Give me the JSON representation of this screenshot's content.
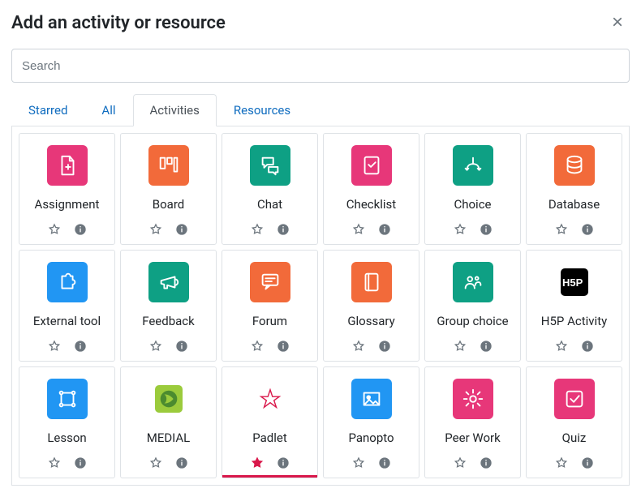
{
  "header": {
    "title": "Add an activity or resource"
  },
  "search": {
    "placeholder": "Search"
  },
  "tabs": {
    "starred": "Starred",
    "all": "All",
    "activities": "Activities",
    "resources": "Resources",
    "active": "activities"
  },
  "colors": {
    "pink": "#e73779",
    "green": "#0ea084",
    "orange": "#f26a3a",
    "blue": "#2196f3",
    "yellowgreen": "#9bcb3c",
    "black": "#000000",
    "white": "#ffffff"
  },
  "items": [
    {
      "id": "assignment",
      "label": "Assignment",
      "bg": "pink",
      "icon": "file-plus",
      "starred": false
    },
    {
      "id": "board",
      "label": "Board",
      "bg": "orange",
      "icon": "kanban",
      "starred": false
    },
    {
      "id": "chat",
      "label": "Chat",
      "bg": "green",
      "icon": "bubbles",
      "starred": false
    },
    {
      "id": "checklist",
      "label": "Checklist",
      "bg": "pink",
      "icon": "check-box",
      "starred": false
    },
    {
      "id": "choice",
      "label": "Choice",
      "bg": "green",
      "icon": "fork",
      "starred": false
    },
    {
      "id": "database",
      "label": "Database",
      "bg": "orange",
      "icon": "db",
      "starred": false
    },
    {
      "id": "externaltool",
      "label": "External tool",
      "bg": "blue",
      "icon": "puzzle",
      "starred": false
    },
    {
      "id": "feedback",
      "label": "Feedback",
      "bg": "green",
      "icon": "megaphone",
      "starred": false
    },
    {
      "id": "forum",
      "label": "Forum",
      "bg": "orange",
      "icon": "speech",
      "starred": false
    },
    {
      "id": "glossary",
      "label": "Glossary",
      "bg": "orange",
      "icon": "book",
      "starred": false
    },
    {
      "id": "groupchoice",
      "label": "Group choice",
      "bg": "green",
      "icon": "group",
      "starred": false
    },
    {
      "id": "h5p",
      "label": "H5P Activity",
      "bg": "black",
      "icon": "h5p",
      "starred": false
    },
    {
      "id": "lesson",
      "label": "Lesson",
      "bg": "blue",
      "icon": "path",
      "starred": false
    },
    {
      "id": "medial",
      "label": "MEDIAL",
      "bg": "yellowgreen",
      "icon": "medial",
      "starred": false
    },
    {
      "id": "padlet",
      "label": "Padlet",
      "bg": "white",
      "icon": "padlet",
      "starred": true
    },
    {
      "id": "panopto",
      "label": "Panopto",
      "bg": "blue",
      "icon": "image",
      "starred": false
    },
    {
      "id": "peerwork",
      "label": "Peer Work",
      "bg": "pink",
      "icon": "gear",
      "starred": false
    },
    {
      "id": "quiz",
      "label": "Quiz",
      "bg": "pink",
      "icon": "tick-square",
      "starred": false
    }
  ]
}
